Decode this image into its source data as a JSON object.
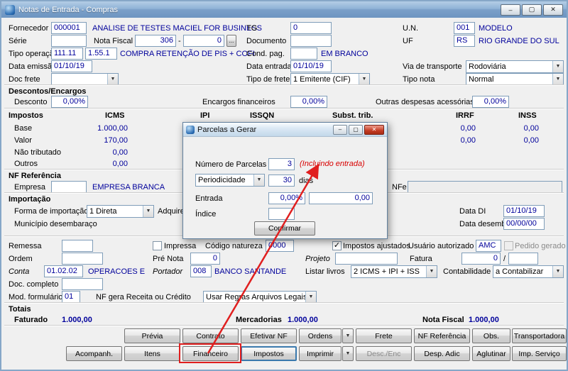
{
  "win": {
    "title": "Notas de Entrada - Compras"
  },
  "icons": {
    "minimize": "–",
    "maximize": "▢",
    "close": "✕",
    "chevron_down": "▼",
    "check": "✓",
    "ellipsis": "..."
  },
  "colors": {
    "value_blue": "#00009B",
    "annotation_red": "#E01F1F"
  },
  "r1": {
    "fornecedor_label": "Fornecedor",
    "fornecedor_code": "000001",
    "fornecedor_name": "ANALISE DE TESTES MACIEL FOR BUSINESS",
    "tg_label": "TG",
    "tg_value": "0",
    "un_label": "U.N.",
    "un_code": "001",
    "un_name": "MODELO"
  },
  "r2": {
    "serie_label": "Série",
    "serie_value": "",
    "nota_fiscal_label": "Nota Fiscal",
    "nf_number": "306",
    "dash": "-",
    "nf_sub": "0",
    "documento_label": "Documento",
    "documento_value": "",
    "uf_label": "UF",
    "uf_code": "RS",
    "uf_name": "RIO GRANDE DO SUL"
  },
  "r3": {
    "tipo_operacao_label": "Tipo operação",
    "tipo_code1": "111.11",
    "tipo_code2": "1.55.1",
    "tipo_desc": "COMPRA RETENÇÃO DE PIS + COFI",
    "cond_pag_label": "Cond. pag.",
    "cond_pag_value": "",
    "cond_pag_desc": "EM BRANCO"
  },
  "r4": {
    "data_emissao_label": "Data emissão",
    "data_emissao": "01/10/19",
    "data_entrada_label": "Data entrada",
    "data_entrada": "01/10/19",
    "via_transporte_label": "Via de transporte",
    "via_transporte": "Rodoviária"
  },
  "r5": {
    "doc_frete_label": "Doc frete",
    "doc_frete": "",
    "tipo_frete_label": "Tipo de frete",
    "tipo_frete": "1 Emitente (CIF)",
    "tipo_nota_label": "Tipo nota",
    "tipo_nota": "Normal"
  },
  "desc": {
    "section": "Descontos/Encargos",
    "desconto_label": "Desconto",
    "desconto": "0,00%",
    "encargos_label": "Encargos financeiros",
    "encargos": "0,00%",
    "outras_label": "Outras despesas acessórias",
    "outras": "0,00%"
  },
  "imp": {
    "section": "Impostos",
    "col_icms": "ICMS",
    "col_ipi": "IPI",
    "col_issqn": "ISSQN",
    "col_subst": "Subst. trib.",
    "col_irrf": "IRRF",
    "col_inss": "INSS",
    "base_label": "Base",
    "base_icms": "1.000,00",
    "base_irrf": "0,00",
    "base_inss": "0,00",
    "valor_label": "Valor",
    "valor_icms": "170,00",
    "valor_irrf": "0,00",
    "valor_inss": "0,00",
    "nao_trib_label": "Não tributado",
    "nao_trib_icms": "0,00",
    "outros_label": "Outros",
    "outros_icms": "0,00"
  },
  "nfref": {
    "section": "NF Referência",
    "empresa_label": "Empresa",
    "empresa_value": "",
    "empresa_name": "EMPRESA BRANCA",
    "nfe_label": "NFe",
    "nfe_value": ""
  },
  "impq": {
    "section": "Importação",
    "forma_label": "Forma de importação",
    "forma": "1 Direta",
    "adquirente_label": "Adquirente",
    "data_di_label": "Data DI",
    "data_di": "01/10/19",
    "municipio_label": "Município desembaraço",
    "data_desembaraco_label": "Data desembaraço",
    "data_desembaraco": "00/00/00"
  },
  "mid": {
    "remessa_label": "Remessa",
    "remessa_value": "",
    "impressa_label": "Impressa",
    "codigo_natureza_label": "Código natureza",
    "codigo_natureza": "0000",
    "impostos_ajustados_label": "Impostos ajustados",
    "usuario_label": "Usuário autorizado",
    "usuario": "AMC",
    "pedido_gerado_label": "Pedido gerado",
    "ordem_label": "Ordem",
    "ordem_value": "",
    "pre_nota_label": "Pré Nota",
    "pre_nota": "0",
    "projeto_label": "Projeto",
    "projeto_value": "",
    "fatura_label": "Fatura",
    "fatura": "0",
    "fatura_sep": "/",
    "fatura2": "",
    "conta_label": "Conta",
    "conta": "01.02.02",
    "conta_desc": "OPERACOES E",
    "portador_label": "Portador",
    "portador": "008",
    "portador_desc": "BANCO SANTANDE",
    "listar_livros_label": "Listar livros",
    "listar_livros": "2 ICMS + IPI + ISS",
    "contabilidade_label": "Contabilidade",
    "contabilidade": "a Contabilizar",
    "doc_completo_label": "Doc. completo",
    "doc_completo": "",
    "mod_formulario_label": "Mod. formulário",
    "mod_formulario": "01",
    "nf_gera_label": "NF gera Receita ou Crédito",
    "nf_gera": "Usar Regras Arquivos Legais"
  },
  "tot": {
    "section": "Totais",
    "faturado_label": "Faturado",
    "faturado": "1.000,00",
    "mercadorias_label": "Mercadorias",
    "mercadorias": "1.000,00",
    "nota_fiscal_label": "Nota Fiscal",
    "nota_fiscal": "1.000,00"
  },
  "btns": {
    "row1": [
      "Prévia",
      "Contrato",
      "Efetivar NF",
      "Ordens",
      "Frete",
      "NF Referência",
      "Obs.",
      "Transportadora"
    ],
    "row2": [
      "Acompanh.",
      "Itens",
      "Financeiro",
      "Impostos",
      "Imprimir",
      "Desc./Enc",
      "Desp. Adic",
      "Aglutinar",
      "Imp. Serviço"
    ]
  },
  "dlg": {
    "title": "Parcelas a Gerar",
    "num_parcelas_label": "Número de Parcelas",
    "num_parcelas": "3",
    "num_parcelas_note": "(Incluindo entrada)",
    "periodicidade_label": "Periodicidade",
    "periodicidade_value": "30",
    "dias_label": "dias",
    "entrada_label": "Entrada",
    "entrada_pct": "0,00%",
    "entrada_valor": "0,00",
    "indice_label": "Índice",
    "indice_value": "",
    "confirmar": "Confirmar"
  }
}
